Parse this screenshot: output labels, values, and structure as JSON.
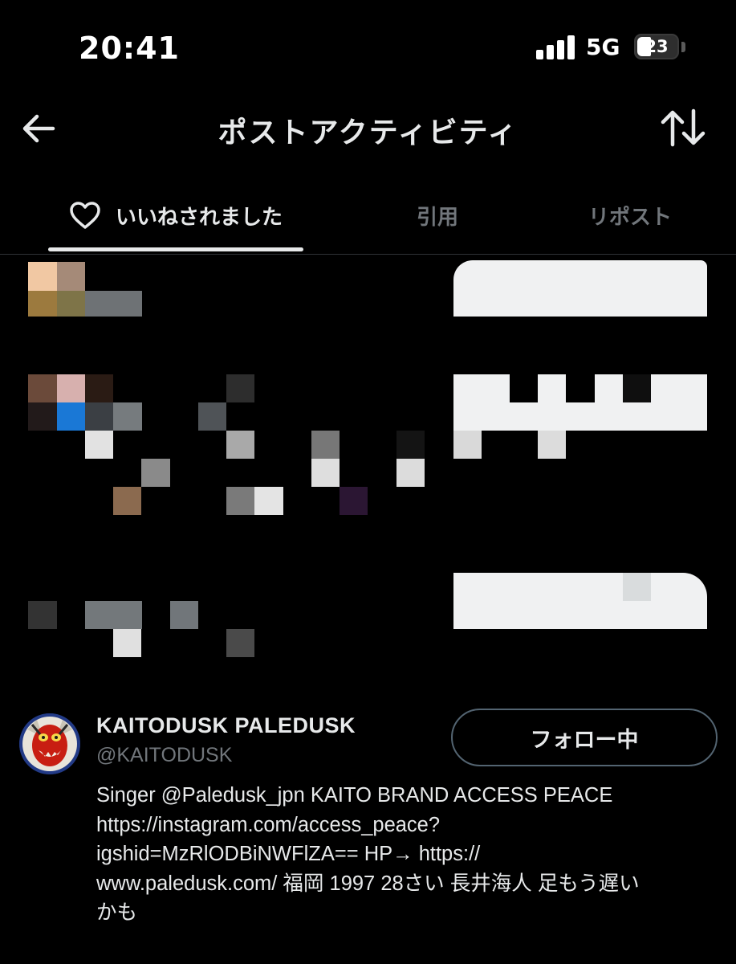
{
  "status_bar": {
    "time": "20:41",
    "network": "5G",
    "battery": "23"
  },
  "header": {
    "back_icon": "arrow-left-icon",
    "title": "ポストアクティビティ",
    "sort_icon": "sort-arrows-icon"
  },
  "tabs": {
    "likes": {
      "label": "いいねされました",
      "icon": "heart-outline-icon",
      "active": true
    },
    "quotes": {
      "label": "引用"
    },
    "reposts": {
      "label": "リポスト"
    }
  },
  "profile": {
    "name": "KAITODUSK PALEDUSK",
    "handle": "@KAITODUSK",
    "follow_label": "フォロー中",
    "bio_lines": [
      "Singer @Paledusk_jpn KAITO BRAND ACCESS PEACE",
      "https://instagram.com/access_peace?",
      "igshid=MzRlODBiNWFlZA== HP→ https://",
      "www.paledusk.com/ 福岡 1997 28さい 長井海人 足もう遅い",
      "かも"
    ]
  },
  "colors": {
    "background": "#000000",
    "text_primary": "#e7e9ea",
    "text_secondary": "#71767b",
    "button_border": "#536471"
  }
}
